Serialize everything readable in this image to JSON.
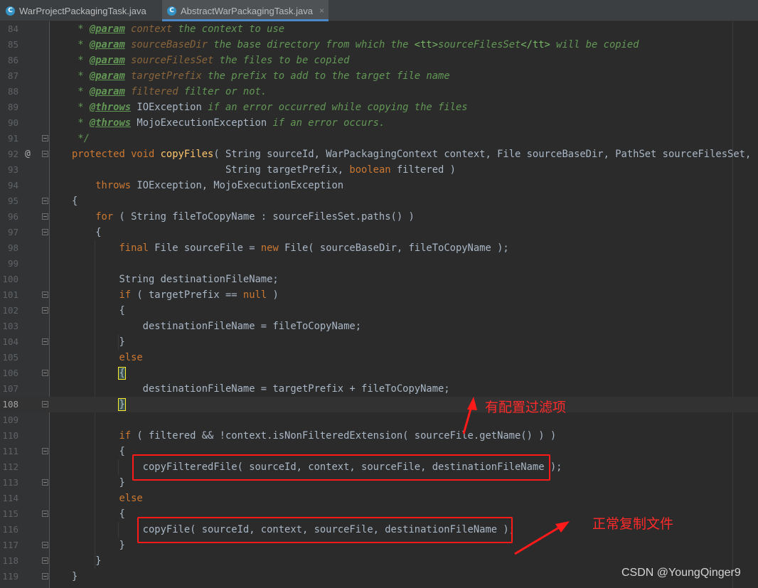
{
  "tabs": [
    {
      "label": "WarProjectPackagingTask.java",
      "icon": "java-class-icon",
      "active": false
    },
    {
      "label": "AbstractWarPackagingTask.java",
      "icon": "java-class-icon",
      "active": true,
      "close": "×"
    }
  ],
  "current_line": 108,
  "override_marker": "@",
  "lines": [
    {
      "n": 84,
      "t": [
        [
          " * ",
          "doc"
        ],
        [
          "@param",
          "tag"
        ],
        [
          " ",
          "doc"
        ],
        [
          "context",
          "par"
        ],
        [
          " the context to use",
          "doc"
        ]
      ]
    },
    {
      "n": 85,
      "t": [
        [
          " * ",
          "doc"
        ],
        [
          "@param",
          "tag"
        ],
        [
          " ",
          "doc"
        ],
        [
          "sourceBaseDir",
          "par"
        ],
        [
          " the base directory from which the ",
          "doc"
        ],
        [
          "<tt>",
          "tt"
        ],
        [
          "sourceFilesSet",
          "doc"
        ],
        [
          "</tt>",
          "tt"
        ],
        [
          " will be copied",
          "doc"
        ]
      ]
    },
    {
      "n": 86,
      "t": [
        [
          " * ",
          "doc"
        ],
        [
          "@param",
          "tag"
        ],
        [
          " ",
          "doc"
        ],
        [
          "sourceFilesSet",
          "par"
        ],
        [
          " the files to be copied",
          "doc"
        ]
      ]
    },
    {
      "n": 87,
      "t": [
        [
          " * ",
          "doc"
        ],
        [
          "@param",
          "tag"
        ],
        [
          " ",
          "doc"
        ],
        [
          "targetPrefix",
          "par"
        ],
        [
          " the prefix to add to the target file name",
          "doc"
        ]
      ]
    },
    {
      "n": 88,
      "t": [
        [
          " * ",
          "doc"
        ],
        [
          "@param",
          "tag"
        ],
        [
          " ",
          "doc"
        ],
        [
          "filtered",
          "par"
        ],
        [
          " filter or not.",
          "doc"
        ]
      ]
    },
    {
      "n": 89,
      "t": [
        [
          " * ",
          "doc"
        ],
        [
          "@throws",
          "tag"
        ],
        [
          " ",
          "doc"
        ],
        [
          "IOException",
          "pl"
        ],
        [
          " if an error occurred while copying the files",
          "doc"
        ]
      ]
    },
    {
      "n": 90,
      "t": [
        [
          " * ",
          "doc"
        ],
        [
          "@throws",
          "tag"
        ],
        [
          " ",
          "doc"
        ],
        [
          "MojoExecutionException",
          "pl"
        ],
        [
          " if an error occurs.",
          "doc"
        ]
      ]
    },
    {
      "n": 91,
      "t": [
        [
          " */",
          "doc"
        ]
      ]
    },
    {
      "n": 92,
      "t": [
        [
          "protected void ",
          "kw"
        ],
        [
          "copyFiles",
          "fn"
        ],
        [
          "( String sourceId, WarPackagingContext context, File sourceBaseDir, PathSet sourceFilesSet,",
          "pl"
        ]
      ]
    },
    {
      "n": 93,
      "t": [
        [
          "                          String targetPrefix, ",
          "pl"
        ],
        [
          "boolean ",
          "kw"
        ],
        [
          "filtered )",
          "pl"
        ]
      ]
    },
    {
      "n": 94,
      "t": [
        [
          "    throws ",
          "kw"
        ],
        [
          "IOException, MojoExecutionException",
          "pl"
        ]
      ]
    },
    {
      "n": 95,
      "t": [
        [
          "{",
          "pl"
        ]
      ]
    },
    {
      "n": 96,
      "t": [
        [
          "    for ",
          "kw"
        ],
        [
          "( String fileToCopyName : sourceFilesSet.paths() )",
          "pl"
        ]
      ]
    },
    {
      "n": 97,
      "t": [
        [
          "    {",
          "pl"
        ]
      ]
    },
    {
      "n": 98,
      "t": [
        [
          "        final ",
          "kw"
        ],
        [
          "File sourceFile = ",
          "pl"
        ],
        [
          "new ",
          "kw"
        ],
        [
          "File( sourceBaseDir, fileToCopyName );",
          "pl"
        ]
      ]
    },
    {
      "n": 99,
      "t": []
    },
    {
      "n": 100,
      "t": [
        [
          "        String destinationFileName;",
          "pl"
        ]
      ]
    },
    {
      "n": 101,
      "t": [
        [
          "        if ",
          "kw"
        ],
        [
          "( targetPrefix == ",
          "pl"
        ],
        [
          "null ",
          "kw"
        ],
        [
          ")",
          "pl"
        ]
      ]
    },
    {
      "n": 102,
      "t": [
        [
          "        {",
          "pl"
        ]
      ]
    },
    {
      "n": 103,
      "t": [
        [
          "            destinationFileName = fileToCopyName;",
          "pl"
        ]
      ]
    },
    {
      "n": 104,
      "t": [
        [
          "        }",
          "pl"
        ]
      ]
    },
    {
      "n": 105,
      "t": [
        [
          "        else",
          "kw"
        ]
      ]
    },
    {
      "n": 106,
      "t": [
        [
          "        ",
          "pl"
        ],
        [
          "{",
          "br"
        ]
      ]
    },
    {
      "n": 107,
      "t": [
        [
          "            destinationFileName = targetPrefix + fileToCopyName;",
          "pl"
        ]
      ]
    },
    {
      "n": 108,
      "t": [
        [
          "        ",
          "pl"
        ],
        [
          "}",
          "br"
        ]
      ]
    },
    {
      "n": 109,
      "t": []
    },
    {
      "n": 110,
      "t": [
        [
          "        if ",
          "kw"
        ],
        [
          "( filtered && !context.isNonFilteredExtension( sourceFile.getName() ) )",
          "pl"
        ]
      ]
    },
    {
      "n": 111,
      "t": [
        [
          "        {",
          "pl"
        ]
      ]
    },
    {
      "n": 112,
      "t": [
        [
          "            copyFilteredFile( sourceId, context, sourceFile, destinationFileName );",
          "pl"
        ]
      ]
    },
    {
      "n": 113,
      "t": [
        [
          "        }",
          "pl"
        ]
      ]
    },
    {
      "n": 114,
      "t": [
        [
          "        else",
          "kw"
        ]
      ]
    },
    {
      "n": 115,
      "t": [
        [
          "        {",
          "pl"
        ]
      ]
    },
    {
      "n": 116,
      "t": [
        [
          "            copyFile( sourceId, context, sourceFile, destinationFileName );",
          "pl"
        ]
      ]
    },
    {
      "n": 117,
      "t": [
        [
          "        }",
          "pl"
        ]
      ]
    },
    {
      "n": 118,
      "t": [
        [
          "    }",
          "pl"
        ]
      ]
    },
    {
      "n": 119,
      "t": [
        [
          "}",
          "pl"
        ]
      ]
    }
  ],
  "fold_lines": [
    91,
    92,
    95,
    96,
    97,
    101,
    102,
    104,
    106,
    108,
    111,
    113,
    115,
    117,
    118,
    119
  ],
  "annotations": {
    "filter_note": "有配置过滤项",
    "copy_note": "正常复制文件",
    "annotation_color": "#ff1a1a"
  },
  "watermark": "CSDN @YoungQinger9"
}
